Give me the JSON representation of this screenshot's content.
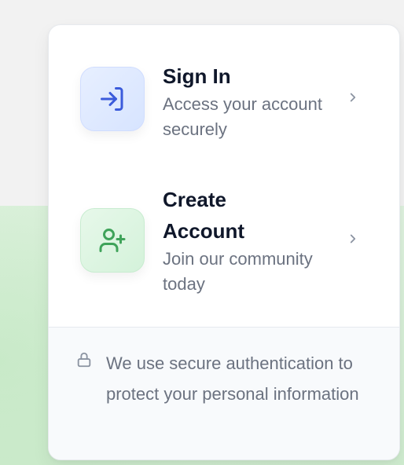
{
  "menu": {
    "signin": {
      "title": "Sign In",
      "subtitle": "Access your account securely",
      "icon": "sign-in-icon",
      "accent": "#3b5bdb"
    },
    "create": {
      "title": "Create Account",
      "subtitle": "Join our community today",
      "icon": "user-plus-icon",
      "accent": "#3fa35a"
    }
  },
  "footer": {
    "note": "We use secure authentication to protect your personal information",
    "icon": "lock-icon"
  }
}
